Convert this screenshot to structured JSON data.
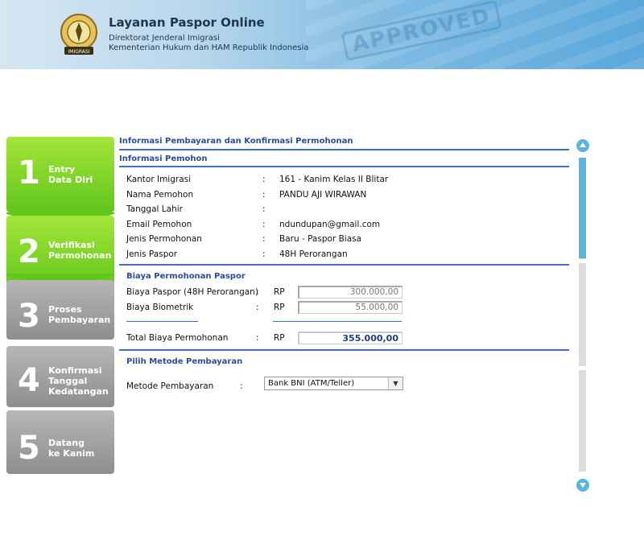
{
  "header": {
    "title": "Layanan Paspor Online",
    "subtitle1": "Direktorat Jenderal Imigrasi",
    "subtitle2": "Kementerian Hukum dan HAM Republik Indonesia",
    "logo_text": "IMIGRASI",
    "stamp_text": "APPROVED"
  },
  "steps": [
    {
      "num": "1",
      "label": "Entry\nData Diri",
      "status": "done",
      "color": "#6fd21f"
    },
    {
      "num": "2",
      "label": "Verifikasi\nPermohonan",
      "status": "active",
      "color": "#6fd21f"
    },
    {
      "num": "3",
      "label": "Proses\nPembayaran",
      "status": "pending",
      "color": "#9c9c9c"
    },
    {
      "num": "4",
      "label": "Konfirmasi\nTanggal\nKedatangan",
      "status": "pending",
      "color": "#9c9c9c"
    },
    {
      "num": "5",
      "label": "Datang\nke Kanim",
      "status": "pending",
      "color": "#9c9c9c"
    }
  ],
  "main": {
    "page_title": "Informasi Pembayaran dan Konfirmasi Permohonan",
    "applicant_section": "Informasi Pemohon",
    "applicant": [
      {
        "label": "Kantor Imigrasi",
        "value": "161 - Kanim Kelas II Blitar"
      },
      {
        "label": "Nama Pemohon",
        "value": "PANDU AJI WIRAWAN"
      },
      {
        "label": "Tanggal Lahir",
        "value": ""
      },
      {
        "label": "Email Pemohon",
        "value": "ndundupan@gmail.com"
      },
      {
        "label": "Jenis Permohonan",
        "value": "Baru - Paspor Biasa"
      },
      {
        "label": "Jenis Paspor",
        "value": "48H Perorangan"
      }
    ],
    "fee_section": "Biaya Permohonan Paspor",
    "fees": [
      {
        "label": "Biaya Paspor (48H Perorangan)",
        "currency": "RP",
        "amount": "300.000,00"
      },
      {
        "label": "Biaya Biometrik",
        "currency": "RP",
        "amount": "55.000,00"
      }
    ],
    "total": {
      "label": "Total Biaya Permohonan",
      "currency": "RP",
      "amount": "355.000,00"
    },
    "payment_section": "Pilih Metode Pembayaran",
    "payment_label": "Metode Pembayaran",
    "payment_selected": "Bank BNI (ATM/Teller)"
  },
  "colors": {
    "accent_blue": "#3f6bc9",
    "step_green": "#6fd21f",
    "step_gray": "#9c9c9c",
    "scroll_blue": "#5ab5dd"
  }
}
